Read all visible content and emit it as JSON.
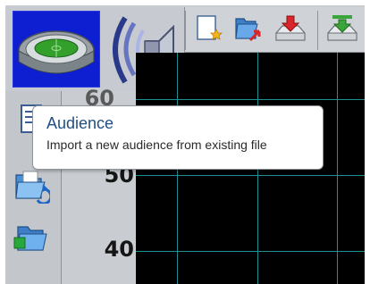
{
  "hero": {
    "stadium_icon": "stadium-icon",
    "speaker_icon": "speaker-icon",
    "stadium_background": "#0d1fd0"
  },
  "toolbar": {
    "buttons": [
      {
        "icon": "new-file-icon"
      },
      {
        "icon": "folder-export-icon"
      },
      {
        "icon": "download-tray-red-icon"
      },
      {
        "icon": "download-tray-green-icon"
      }
    ]
  },
  "left_toolbar": {
    "buttons": [
      {
        "icon": "document-list-icon"
      },
      {
        "icon": "folder-import-audience-icon"
      },
      {
        "icon": "folder-open-icon"
      }
    ]
  },
  "axis": {
    "ticks": [
      "50",
      "40"
    ],
    "partial_top_tick": "60"
  },
  "plot": {
    "background": "#000000",
    "grid_color": "#1e8f93"
  },
  "tooltip": {
    "title": "Audience",
    "description": "Import a new audience from existing file"
  }
}
